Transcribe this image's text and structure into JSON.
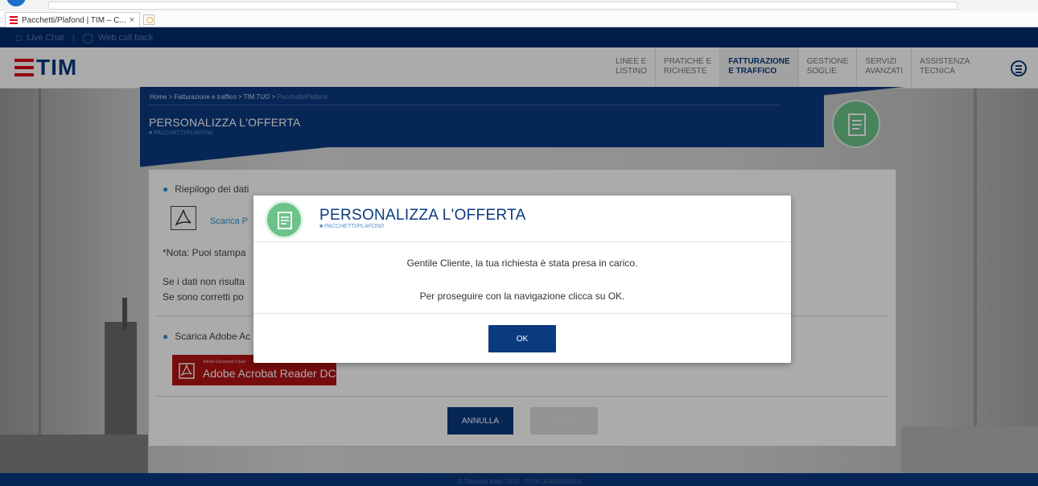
{
  "browser": {
    "tab_title": "Pacchetti/Plafond | TIM – C...",
    "tab_close": "×"
  },
  "util_bar": {
    "live_chat": "Live Chat",
    "separator": "|",
    "web_call_back": "Web call back"
  },
  "header": {
    "logo_text": "TIM",
    "nav": [
      {
        "line1": "LINEE E",
        "line2": "LISTINO"
      },
      {
        "line1": "PRATICHE E",
        "line2": "RICHIESTE"
      },
      {
        "line1": "FATTURAZIONE",
        "line2": "E TRAFFICO"
      },
      {
        "line1": "GESTIONE",
        "line2": "SOGLIE"
      },
      {
        "line1": "SERVIZI",
        "line2": "AVANZATI"
      },
      {
        "line1": "ASSISTENZA",
        "line2": "TECNICA"
      }
    ]
  },
  "breadcrumb": {
    "path": "Home > Fatturazione e traffico > TIM TUO > ",
    "current": "Pacchetti/Plafond"
  },
  "page": {
    "title": "PERSONALIZZA L'OFFERTA",
    "subtitle": "■ PACCHETTI/PLAFOND"
  },
  "panel": {
    "section1": "Riepilogo dei dati",
    "download_link": "Scarica P",
    "note": "*Nota: Puoi stampa",
    "line1": "Se i dati non risulta",
    "line2": "Se sono corretti po",
    "section2": "Scarica Adobe Ac",
    "adobe_small": "Adobe Document Cloud",
    "adobe_name": "Adobe Acrobat Reader DC",
    "btn_annulla": "ANNULLA",
    "btn_invia": "INVIA"
  },
  "modal": {
    "title": "PERSONALIZZA L'OFFERTA",
    "subtitle": "■ PACCHETTI/PLAFOND",
    "message1": "Gentile Cliente, la tua richiesta è stata presa in carico.",
    "message2": "Per proseguire con la navigazione clicca su OK.",
    "ok": "OK"
  },
  "footer": {
    "text": "© Telecom Italia 2020 - P.IVA 00488410010"
  },
  "colors": {
    "brand_blue": "#0a3a80",
    "tim_red": "#e2001a",
    "accent_green": "#6cc38a",
    "link_blue": "#2f8fd6",
    "adobe_red": "#b01313"
  }
}
